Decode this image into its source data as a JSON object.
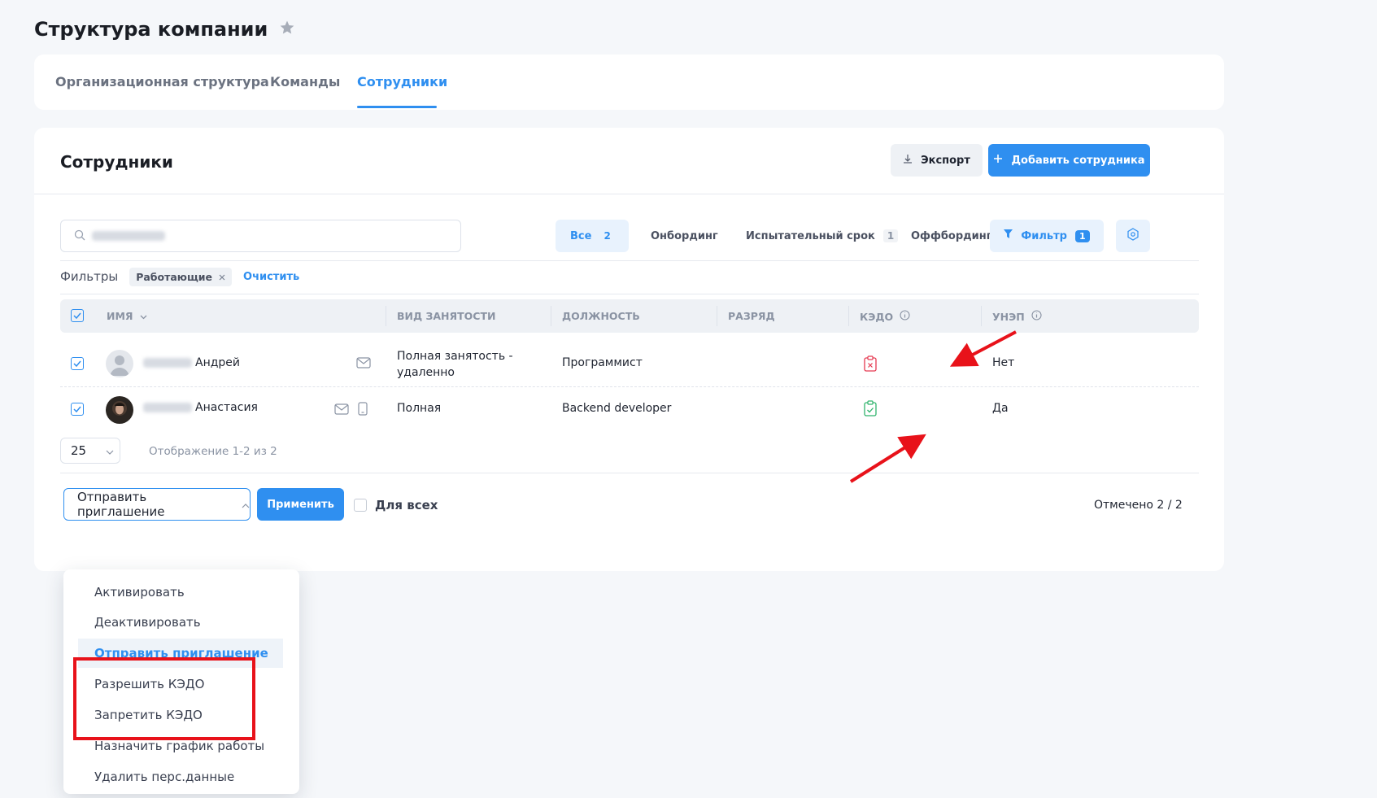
{
  "page": {
    "title": "Структура компании"
  },
  "tabs": [
    {
      "label": "Организационная структура"
    },
    {
      "label": "Команды"
    },
    {
      "label": "Сотрудники"
    }
  ],
  "section": {
    "title": "Сотрудники",
    "export_label": "Экспорт",
    "add_label": "Добавить сотрудника"
  },
  "status_tabs": [
    {
      "label": "Все",
      "count": "2"
    },
    {
      "label": "Онбординг",
      "count": ""
    },
    {
      "label": "Испытательный срок",
      "count": "1"
    },
    {
      "label": "Оффбординг",
      "count": ""
    }
  ],
  "filter_button": {
    "label": "Фильтр",
    "count": "1"
  },
  "filters": {
    "label": "Фильтры",
    "tag": "Работающие",
    "clear_label": "Очистить"
  },
  "table": {
    "columns": [
      "Имя",
      "Вид занятости",
      "Должность",
      "Разряд",
      "КЭДО",
      "УНЭП"
    ],
    "rows": [
      {
        "name": "Андрей",
        "employment_line1": "Полная занятость -",
        "employment_line2": "удаленно",
        "position": "Программист",
        "grade": "",
        "kedo": "disabled",
        "unep": "Нет"
      },
      {
        "name": "Анастасия",
        "employment_line1": "Полная",
        "employment_line2": "",
        "position": "Backend developer",
        "grade": "",
        "kedo": "enabled",
        "unep": "Да"
      }
    ]
  },
  "pagination": {
    "page_size": "25",
    "summary": "Отображение 1-2 из 2"
  },
  "bulk": {
    "action_value": "Отправить приглашение",
    "apply_label": "Применить",
    "for_all_label": "Для всех",
    "selected_summary": "Отмечено 2 / 2"
  },
  "dropdown": {
    "items": [
      "Активировать",
      "Деактивировать",
      "Отправить приглашение",
      "Разрешить КЭДО",
      "Запретить КЭДО",
      "Назначить график работы",
      "Удалить перс.данные"
    ],
    "selected_index": 2
  },
  "colors": {
    "accent": "#2f8ff0",
    "kedo_disabled": "#e53950",
    "kedo_enabled": "#2fb36c",
    "annotation": "#e8121a"
  }
}
